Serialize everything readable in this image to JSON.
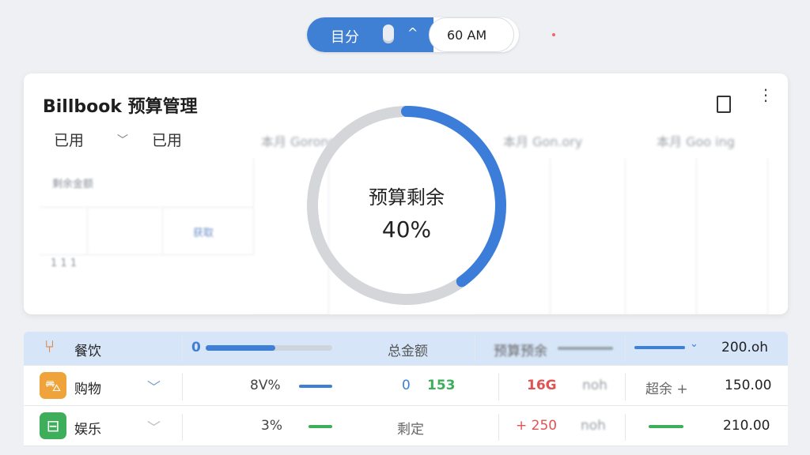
{
  "top_bar": {
    "toggle_label": "目分",
    "time_label": "60 AM"
  },
  "card": {
    "title": "Billbook 预算管理",
    "filters": [
      {
        "label": "已用"
      },
      {
        "label": "已用"
      },
      {
        "label": "本月 Gorong"
      },
      {
        "label": "本月 Gon.ory"
      },
      {
        "label": "本月 Goo ing"
      }
    ],
    "grid": {
      "header_label": "剩余金额",
      "tag_label": "获取",
      "stepper_text": "1 1 1"
    }
  },
  "donut": {
    "label": "预算剩余",
    "value_text": "40%",
    "remaining_fraction": 0.4,
    "colors": {
      "remaining": "#3b7dd8",
      "used": "#d4d6da"
    }
  },
  "table": {
    "header": {
      "category": "餐饮",
      "progress_num": "0",
      "progress_fraction": 0.55,
      "col_amount": "总金额",
      "col_budget": "预算预余",
      "amount": "200.oh"
    },
    "rows": [
      {
        "category": "购物",
        "icon": "shopping-basket-icon",
        "icon_color": "#f0a33a",
        "percent": "8V%",
        "val_a": "0",
        "val_b": "153",
        "val_c": "16G",
        "val_d": "noh",
        "tag": "超余 +",
        "amount": "150.00"
      },
      {
        "category": "娱乐",
        "icon": "gamepad-icon",
        "icon_color": "#3fae5a",
        "percent": "3%",
        "val_a": "剩定",
        "val_b": "",
        "val_c": "+ 250",
        "val_d": "noh",
        "tag": "",
        "amount": "210.00"
      }
    ]
  }
}
